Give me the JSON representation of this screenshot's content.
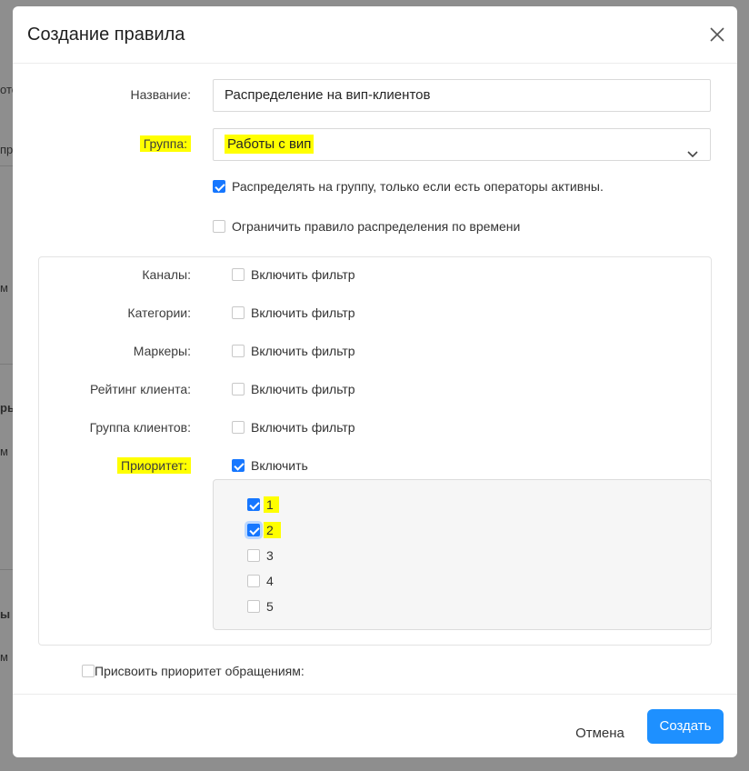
{
  "dialog": {
    "title": "Создание правила",
    "close_icon": "close-icon"
  },
  "form": {
    "name_label": "Название:",
    "name_value": "Распределение на вип-клиентов",
    "group_label": "Группа:",
    "group_value": "Работы с вип",
    "distribute_only_active": {
      "label": "Распределять на группу, только если есть операторы активны.",
      "checked": true
    },
    "limit_by_time": {
      "label": "Ограничить правило распределения по времени",
      "checked": false
    },
    "filters": [
      {
        "label": "Каналы:",
        "option": "Включить фильтр",
        "checked": false
      },
      {
        "label": "Категории:",
        "option": "Включить фильтр",
        "checked": false
      },
      {
        "label": "Маркеры:",
        "option": "Включить фильтр",
        "checked": false
      },
      {
        "label": "Рейтинг клиента:",
        "option": "Включить фильтр",
        "checked": false
      },
      {
        "label": "Группа клиентов:",
        "option": "Включить фильтр",
        "checked": false
      }
    ],
    "priority": {
      "label": "Приоритет:",
      "option": "Включить",
      "checked": true,
      "levels": [
        {
          "value": "1",
          "checked": true
        },
        {
          "value": "2",
          "checked": true
        },
        {
          "value": "3",
          "checked": false
        },
        {
          "value": "4",
          "checked": false
        },
        {
          "value": "5",
          "checked": false
        }
      ]
    },
    "assign_priority": {
      "label": "Присвоить приоритет обращениям:",
      "checked": false
    }
  },
  "footer": {
    "cancel_label": "Отмена",
    "create_label": "Создать"
  },
  "background": {
    "fragments": [
      "ото",
      "пре",
      "м",
      "ры",
      "м",
      "ы",
      "м"
    ]
  },
  "colors": {
    "primary": "#1e90ff",
    "checkbox_checked": "#1677ff",
    "highlight": "#ffff00"
  }
}
